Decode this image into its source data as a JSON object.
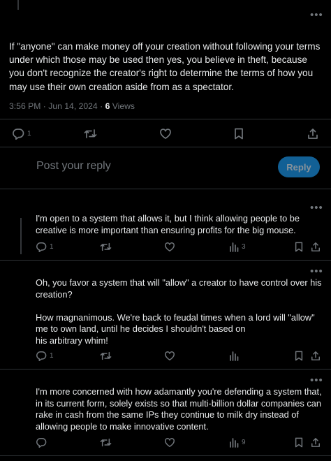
{
  "main_post": {
    "text": "If \"anyone\" can make money off your creation without following your terms under which those may be used then yes, you believe in theft, because you don't recognize the creator's right to determine the terms of how you may use their own creation aside from as a spectator.",
    "time": "3:56 PM",
    "separator": "·",
    "date": "Jun 14, 2024",
    "views_count": "6",
    "views_label": "Views",
    "reply_count": "1"
  },
  "composer": {
    "placeholder": "Post your reply",
    "button_label": "Reply"
  },
  "replies": [
    {
      "text": "I'm open to a system that allows it, but I think allowing people to be creative is more important than ensuring profits for the big mouse.",
      "reply_count": "1",
      "views_count": "3"
    },
    {
      "text": "Oh, you favor a system that will \"allow\" a creator to have control over his creation?\n\nHow magnanimous. We're back to feudal times when a lord will \"allow\" me to own land, until he decides I shouldn't based on\n his arbitrary whim!",
      "reply_count": "1",
      "views_count": ""
    },
    {
      "text": "I'm more concerned with how adamantly you're defending a system that, in its current form, solely exists so that multi-billion dollar companies can rake in cash from the same IPs they continue to milk dry instead of allowing people to make innovative content.",
      "reply_count": "",
      "views_count": "9"
    }
  ],
  "icons": {
    "reply": "speech-bubble-icon",
    "repost": "repost-arrows-icon",
    "like": "heart-icon",
    "views": "bar-chart-icon",
    "bookmark": "bookmark-icon",
    "share": "share-arrow-icon",
    "more": "more-dots-icon"
  },
  "colors": {
    "background": "#000000",
    "text": "#e7e9ea",
    "muted": "#71767b",
    "accent": "#1d9bf0",
    "divider": "#2f3336"
  }
}
